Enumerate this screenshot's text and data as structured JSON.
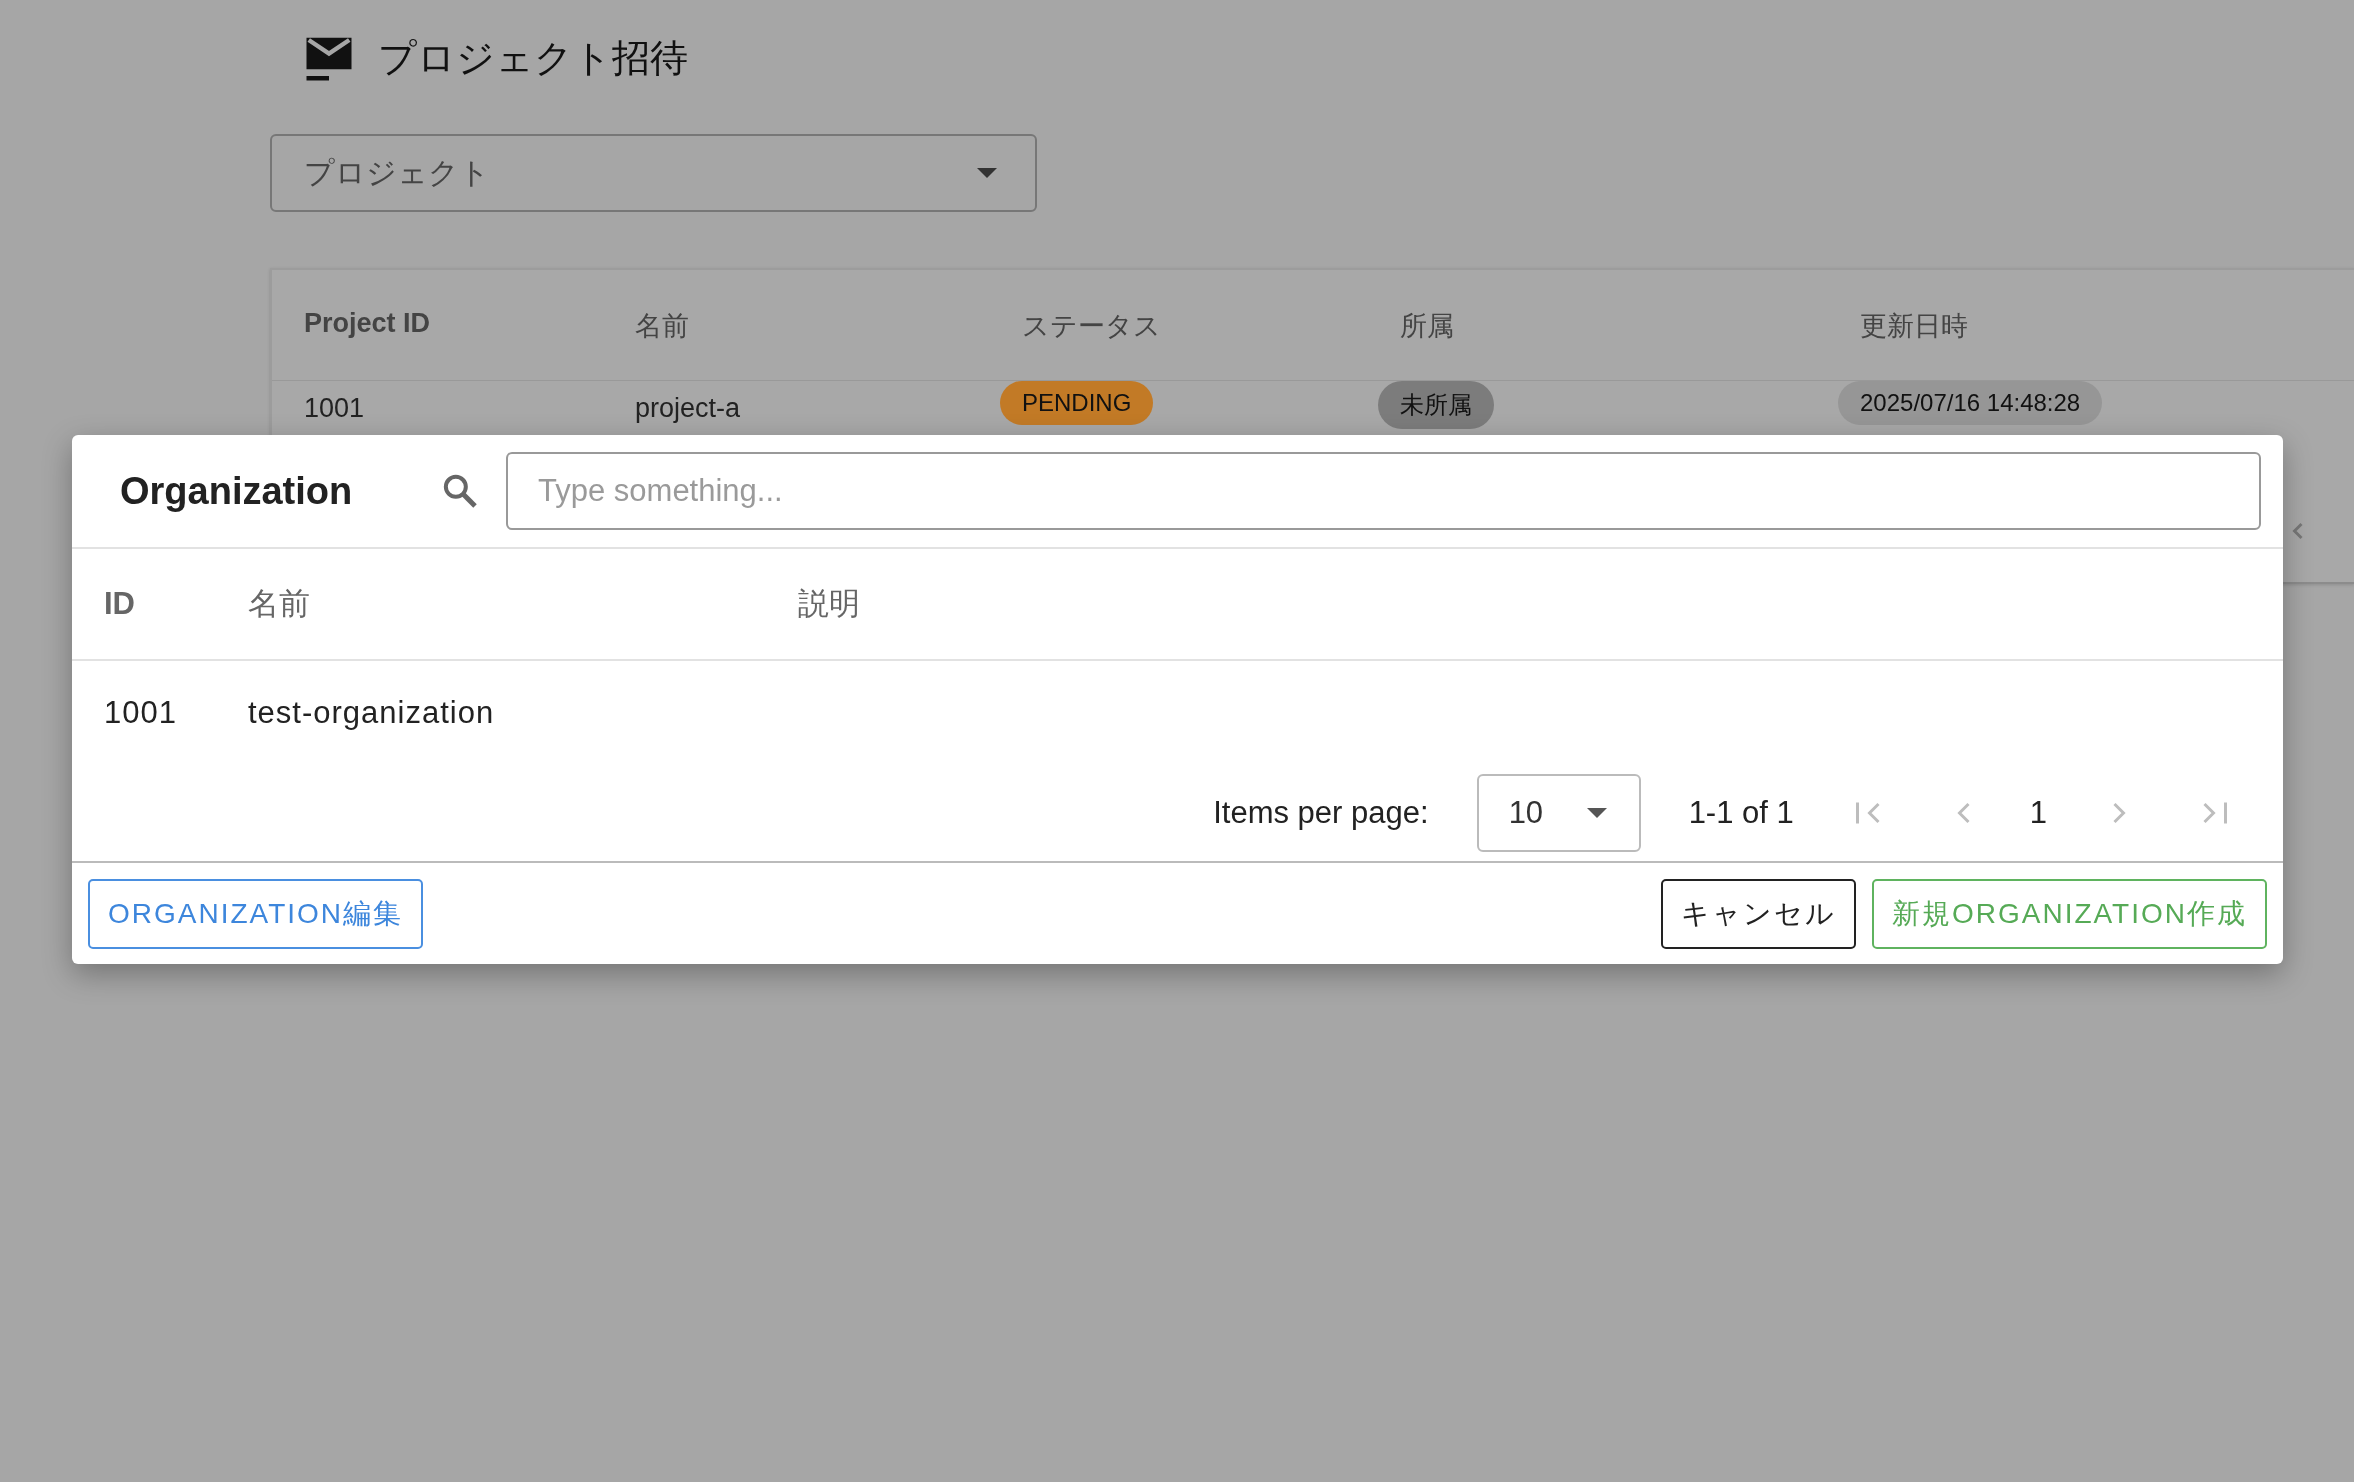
{
  "page": {
    "title": "プロジェクト招待",
    "project_select": {
      "placeholder": "プロジェクト"
    },
    "table": {
      "columns": [
        "Project ID",
        "名前",
        "ステータス",
        "所属",
        "更新日時"
      ],
      "rows": [
        {
          "cells": [
            {
              "text": "1001",
              "kind": "plain"
            },
            {
              "text": "project-a",
              "kind": "plain"
            },
            {
              "text": "PENDING",
              "kind": "chip",
              "color": "#c27a26"
            },
            {
              "text": "未所属",
              "kind": "chip",
              "color": "#7c7c7c"
            },
            {
              "text": "2025/07/16 14:48:28",
              "kind": "chip",
              "color": "#969696"
            }
          ]
        }
      ]
    }
  },
  "dialog": {
    "title": "Organization",
    "search": {
      "placeholder": "Type something..."
    },
    "table": {
      "columns": [
        "ID",
        "名前",
        "説明"
      ],
      "rows": [
        {
          "cells": [
            "1001",
            "test-organization"
          ]
        }
      ]
    },
    "pagination": {
      "label": "Items per page:",
      "per_page": "10",
      "range": "1-1 of 1",
      "page": "1",
      "nav": [
        {
          "kind": "first",
          "disabled": true
        },
        {
          "kind": "prev",
          "disabled": true
        },
        {
          "kind": "next",
          "disabled": true
        },
        {
          "kind": "last",
          "disabled": true
        }
      ]
    },
    "buttons": [
      {
        "label": "ORGANIZATION編集",
        "kind": "primary"
      },
      {
        "label": "キャンセル",
        "kind": "default"
      },
      {
        "label": "新規ORGANIZATION作成",
        "kind": "success"
      }
    ]
  }
}
